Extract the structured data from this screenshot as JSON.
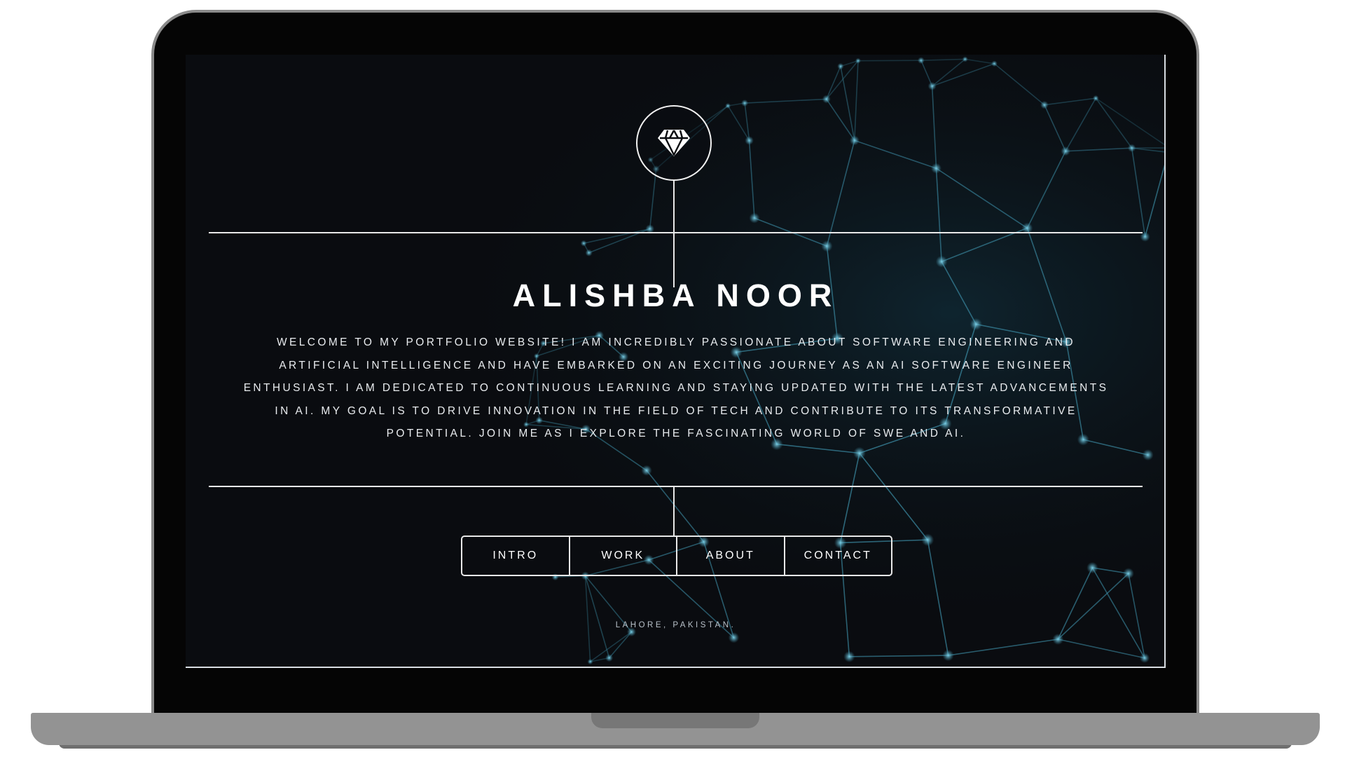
{
  "site": {
    "logo_icon": "diamond-icon",
    "name": "ALISHBA NOOR",
    "bio": "WELCOME TO MY PORTFOLIO WEBSITE! I AM INCREDIBLY PASSIONATE ABOUT SOFTWARE ENGINEERING AND ARTIFICIAL INTELLIGENCE AND HAVE EMBARKED ON AN EXCITING JOURNEY AS AN AI SOFTWARE ENGINEER ENTHUSIAST. I AM DEDICATED TO CONTINUOUS LEARNING AND STAYING UPDATED WITH THE LATEST ADVANCEMENTS IN AI. MY GOAL IS TO DRIVE INNOVATION IN THE FIELD OF TECH AND CONTRIBUTE TO ITS TRANSFORMATIVE POTENTIAL. JOIN ME AS I EXPLORE THE FASCINATING WORLD OF SWE AND AI.",
    "nav": [
      "INTRO",
      "WORK",
      "ABOUT",
      "CONTACT"
    ],
    "location": "LAHORE, PAKISTAN."
  },
  "colors": {
    "background": "#0a0c10",
    "text": "#ffffff",
    "line": "#e8e8e8",
    "network_accent": "#3d8fa8"
  }
}
